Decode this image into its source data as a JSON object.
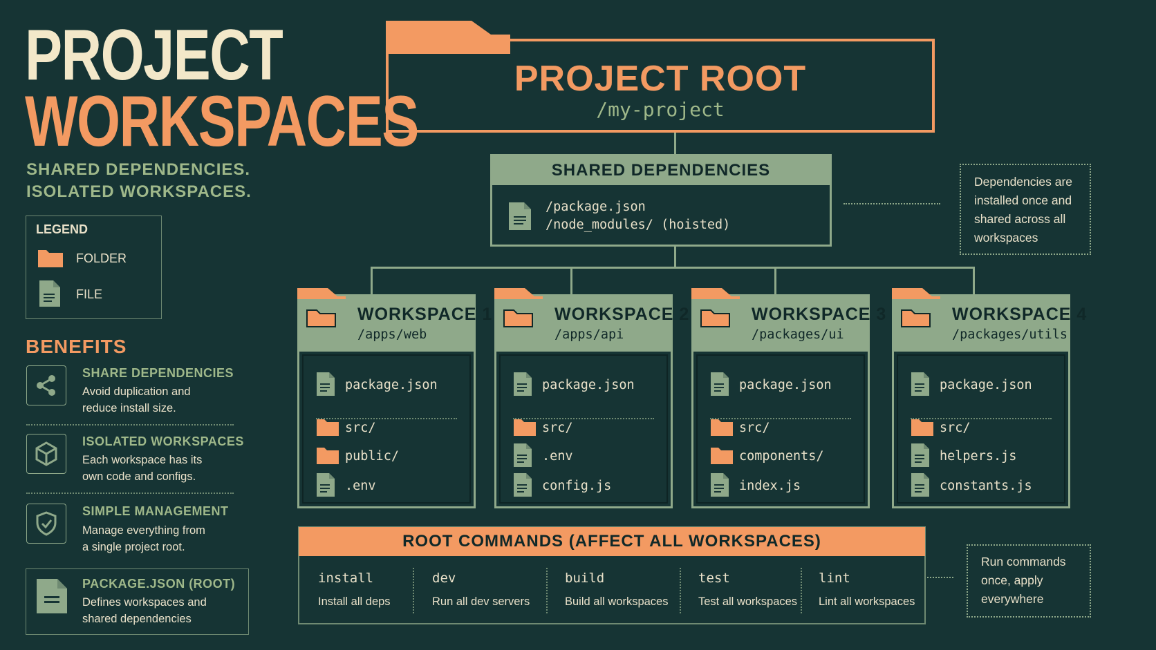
{
  "title": {
    "line1": "PROJECT",
    "line2": "WORKSPACES",
    "tagline1": "SHARED DEPENDENCIES.",
    "tagline2": "ISOLATED WORKSPACES."
  },
  "legend": {
    "title": "LEGEND",
    "folder_label": "FOLDER",
    "file_label": "FILE"
  },
  "benefits": {
    "title": "BENEFITS",
    "items": [
      {
        "heading": "SHARE DEPENDENCIES",
        "text": "Avoid duplication and\nreduce install size.",
        "icon": "share-icon"
      },
      {
        "heading": "ISOLATED WORKSPACES",
        "text": "Each workspace has its\nown code and configs.",
        "icon": "cube-icon"
      },
      {
        "heading": "SIMPLE MANAGEMENT",
        "text": "Manage everything from\na single project root.",
        "icon": "shield-check-icon"
      }
    ],
    "package_json": {
      "heading": "PACKAGE.JSON (ROOT)",
      "text": "Defines workspaces and\nshared dependencies",
      "icon": "file-icon"
    }
  },
  "root": {
    "title": "PROJECT ROOT",
    "path": "/my-project"
  },
  "shared": {
    "title": "SHARED DEPENDENCIES",
    "line1": "/package.json",
    "line2": "/node_modules/ (hoisted)",
    "note": "Dependencies are\ninstalled once and\nshared across all\nworkspaces"
  },
  "workspaces": [
    {
      "title": "WORKSPACE 1",
      "path": "/apps/web",
      "items": [
        {
          "type": "file",
          "name": "package.json"
        },
        {
          "type": "folder",
          "name": "src/"
        },
        {
          "type": "folder",
          "name": "public/"
        },
        {
          "type": "file",
          "name": ".env"
        }
      ]
    },
    {
      "title": "WORKSPACE 2",
      "path": "/apps/api",
      "items": [
        {
          "type": "file",
          "name": "package.json"
        },
        {
          "type": "folder",
          "name": "src/"
        },
        {
          "type": "file",
          "name": ".env"
        },
        {
          "type": "file",
          "name": "config.js"
        }
      ]
    },
    {
      "title": "WORKSPACE 3",
      "path": "/packages/ui",
      "items": [
        {
          "type": "file",
          "name": "package.json"
        },
        {
          "type": "folder",
          "name": "src/"
        },
        {
          "type": "folder",
          "name": "components/"
        },
        {
          "type": "file",
          "name": "index.js"
        }
      ]
    },
    {
      "title": "WORKSPACE 4",
      "path": "/packages/utils",
      "items": [
        {
          "type": "file",
          "name": "package.json"
        },
        {
          "type": "folder",
          "name": "src/"
        },
        {
          "type": "file",
          "name": "helpers.js"
        },
        {
          "type": "file",
          "name": "constants.js"
        }
      ]
    }
  ],
  "commands": {
    "title": "ROOT COMMANDS (AFFECT ALL WORKSPACES)",
    "items": [
      {
        "name": "install",
        "desc": "Install all deps"
      },
      {
        "name": "dev",
        "desc": "Run all dev servers"
      },
      {
        "name": "build",
        "desc": "Build all workspaces"
      },
      {
        "name": "test",
        "desc": "Test all workspaces"
      },
      {
        "name": "lint",
        "desc": "Lint all workspaces"
      }
    ],
    "note": "Run commands\nonce, apply\neverywhere"
  },
  "colors": {
    "background": "#163434",
    "accent_orange": "#f39a62",
    "accent_green": "#8fa98a",
    "cream": "#f3e8c9"
  }
}
